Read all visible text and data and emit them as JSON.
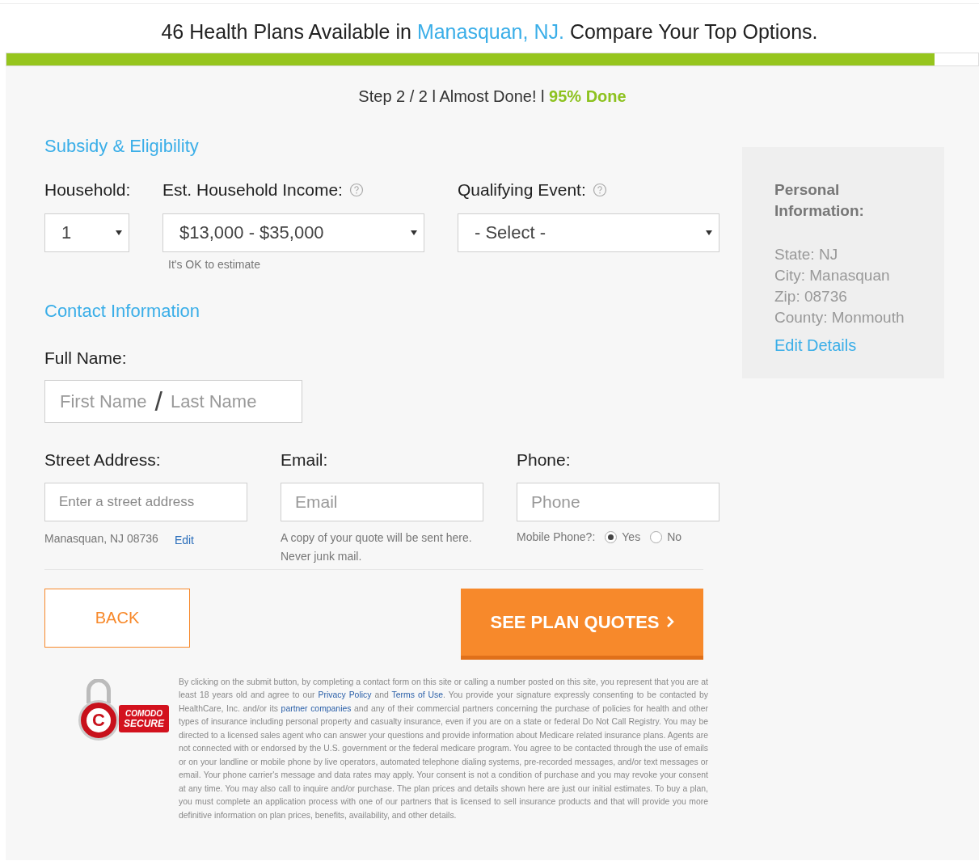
{
  "header": {
    "before": "46 Health Plans Available in",
    "location": "Manasquan, NJ.",
    "after": "Compare Your Top Options."
  },
  "progress": {
    "level": 0.955
  },
  "step": {
    "text": "Step 2 / 2 l Almost Done! l",
    "percent": "95% Done"
  },
  "subsidy": {
    "title": "Subsidy & Eligibility",
    "household": {
      "label": "Household:",
      "value": "1"
    },
    "income": {
      "label": "Est. Household Income:",
      "value": "$13,000 - $35,000",
      "hint": "It's OK to estimate"
    },
    "event": {
      "label": "Qualifying Event:",
      "value": "- Select -"
    }
  },
  "contact": {
    "title": "Contact Information",
    "full_name": {
      "label": "Full Name:",
      "first_placeholder": "First Name",
      "separator": "/",
      "last_placeholder": "Last Name"
    },
    "street": {
      "label": "Street Address:",
      "placeholder": "Enter a street address",
      "location": "Manasquan, NJ 08736",
      "edit": "Edit"
    },
    "email": {
      "label": "Email:",
      "placeholder": "Email",
      "hint": "A copy of your quote will be sent here. Never junk mail."
    },
    "phone": {
      "label": "Phone:",
      "placeholder": "Phone",
      "mobile_label": "Mobile Phone?:",
      "options": [
        {
          "label": "Yes",
          "selected": true
        },
        {
          "label": "No",
          "selected": false
        }
      ]
    }
  },
  "buttons": {
    "back": "BACK",
    "submit": "SEE PLAN QUOTES"
  },
  "badge": {
    "letter": "C",
    "line_1": "COMODO",
    "line_2": "SECURE"
  },
  "disclaimer": [
    {
      "kind": "text",
      "text": "By clicking on the submit button, by completing a contact form on this site or calling a number posted on this site, you represent that you are at least 18 years old and agree to our "
    },
    {
      "kind": "link",
      "text": "Privacy Policy"
    },
    {
      "kind": "text",
      "text": " and "
    },
    {
      "kind": "link",
      "text": "Terms of Use"
    },
    {
      "kind": "text",
      "text": ". You provide your signature expressly consenting to be contacted by HealthCare, Inc. and/or its "
    },
    {
      "kind": "link",
      "text": "partner companies"
    },
    {
      "kind": "text",
      "text": " and any of their commercial partners concerning the purchase of policies for health and other types of insurance including personal property and casualty insurance, even if you are on a state or federal Do Not Call Registry. You may be directed to a licensed sales agent who can answer your questions and provide information about Medicare related insurance plans. Agents are not connected with or endorsed by the U.S. government or the federal medicare program. You agree to be contacted through the use of emails or on your landline or mobile phone by live operators, automated telephone dialing systems, pre-recorded messages, and/or text messages or email. Your phone carrier's message and data rates may apply. Your consent is not a condition of purchase and you may revoke your consent at any time. You may also call to inquire and/or purchase. The plan prices and details shown here are just our initial estimates. To buy a plan, you must complete an application process with one of our partners that is licensed to sell insurance products and that will provide you more definitive information on plan prices, benefits, availability, and other details."
    }
  ],
  "personal": {
    "title": "Personal Information:",
    "lines": [
      "State: NJ",
      "City: Manasquan",
      "Zip: 08736",
      "County: Monmouth"
    ],
    "edit": "Edit Details"
  }
}
